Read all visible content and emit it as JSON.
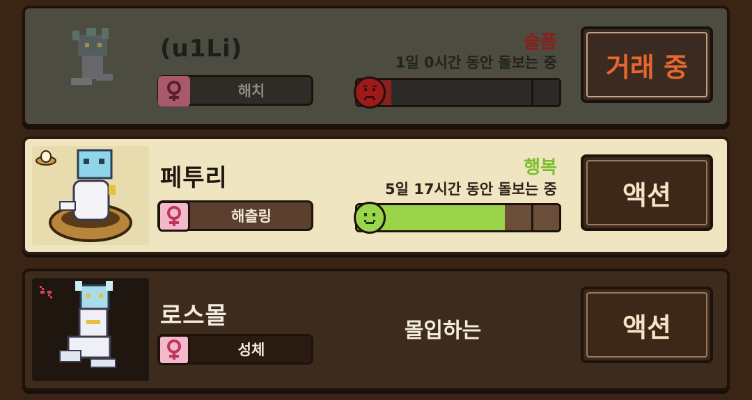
{
  "pets": [
    {
      "name": "(u1Li)",
      "stage": "해치",
      "mood": "슬픔",
      "care_time": "1일 0시간 동안 돌보는 중",
      "mood_level": 0.15,
      "button": "거래 중"
    },
    {
      "name": "페투리",
      "stage": "해츨링",
      "mood": "행복",
      "care_time": "5일 17시간 동안 돌보는 중",
      "mood_level": 0.72,
      "button": "액션"
    },
    {
      "name": "로스몰",
      "stage": "성체",
      "status": "몰입하는",
      "button": "액션"
    }
  ],
  "icons": {
    "gender": "female-icon",
    "sad_face": "sad-face-icon",
    "happy_face": "happy-face-icon",
    "egg_nest": "egg-nest-icon",
    "disconnect": "crossed-link-icon"
  },
  "colors": {
    "sad": "#8b1d1d",
    "happy": "#7ac02c",
    "trade_button_text": "#e8672f",
    "selected_card": "#efe5c0"
  }
}
